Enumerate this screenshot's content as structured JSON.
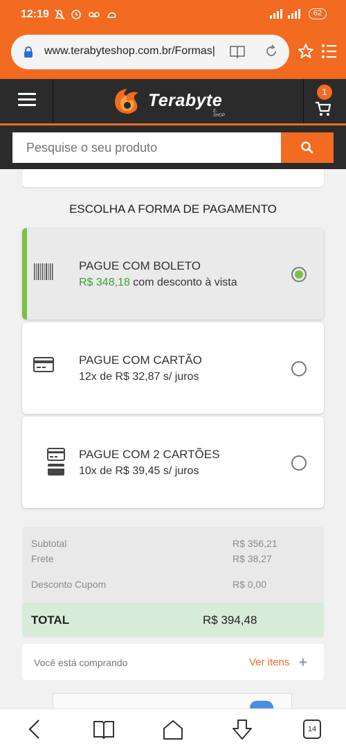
{
  "status": {
    "time": "12:19",
    "battery": "62"
  },
  "browser": {
    "url": "www.terabyteshop.com.br/Formas|",
    "tabs_count": "14"
  },
  "header": {
    "logo_text": "Terabyte",
    "logo_sub": "E-SHOP",
    "cart_count": "1",
    "search_placeholder": "Pesquise o seu produto"
  },
  "payment": {
    "title": "ESCOLHA A FORMA DE PAGAMENTO",
    "options": [
      {
        "title": "PAGUE COM BOLETO",
        "price": "R$ 348,18",
        "sub": "com desconto à vista",
        "selected": true
      },
      {
        "title": "PAGUE COM CARTÃO",
        "sub": "12x de R$ 32,87 s/ juros",
        "selected": false
      },
      {
        "title": "PAGUE COM 2 CARTÕES",
        "sub": "10x de R$ 39,45 s/ juros",
        "selected": false
      }
    ]
  },
  "summary": {
    "subtotal_label": "Subtotal",
    "subtotal_value": "R$ 356,21",
    "frete_label": "Frete",
    "frete_value": "R$ 38,27",
    "cupom_label": "Desconto Cupom",
    "cupom_value": "R$ 0,00",
    "total_label": "TOTAL",
    "total_value": "R$ 394,48"
  },
  "buying": {
    "label": "Você está comprando",
    "link": "Ver itens",
    "plus": "+"
  },
  "colors": {
    "brand_orange": "#f26b21",
    "accent_green": "#7cc242",
    "price_green": "#3aa335",
    "header_dark": "#2b2b2b"
  }
}
